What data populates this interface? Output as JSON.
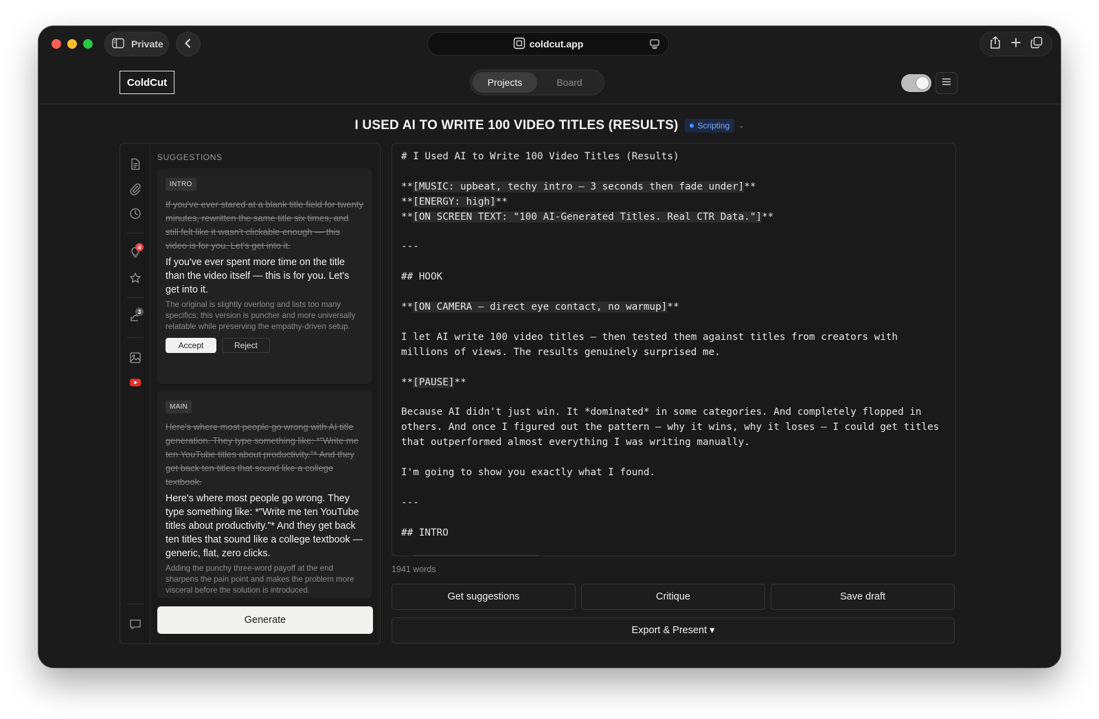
{
  "browser": {
    "private_label": "Private",
    "url": "coldcut.app"
  },
  "app": {
    "logo": "ColdCut",
    "tabs": [
      {
        "label": "Projects",
        "active": true
      },
      {
        "label": "Board",
        "active": false
      }
    ]
  },
  "document": {
    "title": "I USED AI TO WRITE 100 VIDEO TITLES (RESULTS)",
    "status": "Scripting",
    "status_color": "#4d8dff"
  },
  "sidebar_rail": {
    "icons": [
      "document-icon",
      "paperclip-icon",
      "clock-icon",
      "lightbulb-icon",
      "star-icon",
      "share-icon",
      "image-icon",
      "youtube-icon",
      "comment-icon"
    ],
    "lightbulb_badge": "4",
    "share_badge": "3"
  },
  "suggestions": {
    "heading": "SUGGESTIONS",
    "cards": [
      {
        "tag": "INTRO",
        "original": "If you've ever stared at a blank title field for twenty minutes, rewritten the same title six times, and still felt like it wasn't clickable enough — this video is for you. Let's get into it.",
        "suggested": "If you've ever spent more time on the title than the video itself — this is for you. Let's get into it.",
        "reason": "The original is slightly overlong and lists too many specifics; this version is puncher and more universally relatable while preserving the empathy-driven setup.",
        "accept_label": "Accept",
        "reject_label": "Reject"
      },
      {
        "tag": "MAIN",
        "original": "Here's where most people go wrong with AI title generation. They type something like: *\"Write me ten YouTube titles about productivity.\"* And they get back ten titles that sound like a college textbook.",
        "suggested": "Here's where most people go wrong. They type something like: *\"Write me ten YouTube titles about productivity.\"* And they get back ten titles that sound like a college textbook — generic, flat, zero clicks.",
        "reason": "Adding the punchy three-word payoff at the end sharpens the pain point and makes the problem more visceral before the solution is introduced."
      }
    ],
    "generate_label": "Generate"
  },
  "editor": {
    "lines": [
      "# I Used AI to Write 100 Video Titles (Results)",
      "",
      "**[MUSIC: upbeat, techy intro — 3 seconds then fade under]**",
      "**[ENERGY: high]**",
      "**[ON SCREEN TEXT: \"100 AI-Generated Titles. Real CTR Data.\"]**",
      "",
      "---",
      "",
      "## HOOK",
      "",
      "**[ON CAMERA — direct eye contact, no warmup]**",
      "",
      "I let AI write 100 video titles — then tested them against titles from creators with",
      "millions of views. The results genuinely surprised me.",
      "",
      "**[PAUSE]**",
      "",
      "Because AI didn't just win. It *dominated* in some categories. And completely flopped in",
      "others. And once I figured out the pattern — why it wins, why it loses — I could get titles",
      "that outperformed almost everything I was writing manually.",
      "",
      "I'm going to show you exactly what I found.",
      "",
      "---",
      "",
      "## INTRO"
    ],
    "word_count": "1941 words"
  },
  "actions": {
    "get_suggestions": "Get suggestions",
    "critique": "Critique",
    "save_draft": "Save draft",
    "export_present": "Export & Present ▾"
  }
}
